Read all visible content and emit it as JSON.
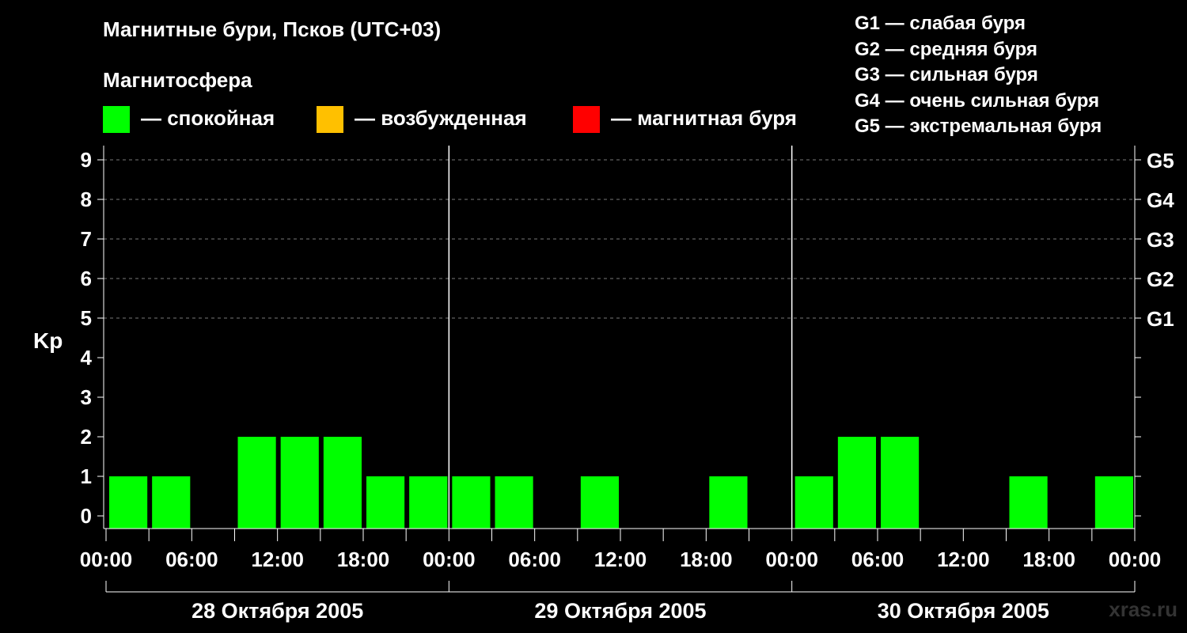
{
  "title": "Магнитные бури, Псков (UTC+03)",
  "magnetosphere_label": "Магнитосфера",
  "legend": [
    {
      "label": "— спокойная",
      "color": "#00ff00"
    },
    {
      "label": "— возбужденная",
      "color": "#ffc000"
    },
    {
      "label": "— магнитная буря",
      "color": "#ff0000"
    }
  ],
  "g_scale": [
    "G1 — слабая буря",
    "G2 — средняя буря",
    "G3 — сильная буря",
    "G4 — очень сильная буря",
    "G5 — экстремальная буря"
  ],
  "site": "xras.ru",
  "chart_data": {
    "type": "bar",
    "ylabel": "Kp",
    "ylim": [
      0,
      9
    ],
    "y_ticks": [
      "0",
      "1",
      "2",
      "3",
      "4",
      "5",
      "6",
      "7",
      "8",
      "9"
    ],
    "right_ticks": [
      {
        "value": 5,
        "label": "G1"
      },
      {
        "value": 6,
        "label": "G2"
      },
      {
        "value": 7,
        "label": "G3"
      },
      {
        "value": 8,
        "label": "G4"
      },
      {
        "value": 9,
        "label": "G5"
      }
    ],
    "grid": "dashed horizontal at Kp 5-9",
    "x_tick_labels": [
      "00:00",
      "06:00",
      "12:00",
      "18:00",
      "00:00",
      "06:00",
      "12:00",
      "18:00",
      "00:00",
      "06:00",
      "12:00",
      "18:00",
      "00:00"
    ],
    "days": [
      "28 Октября 2005",
      "29 Октября 2005",
      "30 Октября 2005"
    ],
    "interval_hours": 3,
    "values": [
      1,
      1,
      0,
      2,
      2,
      2,
      1,
      1,
      1,
      1,
      0,
      1,
      0,
      0,
      1,
      0,
      1,
      2,
      2,
      0,
      0,
      1,
      0,
      1
    ],
    "bar_color": "#00ff00"
  }
}
